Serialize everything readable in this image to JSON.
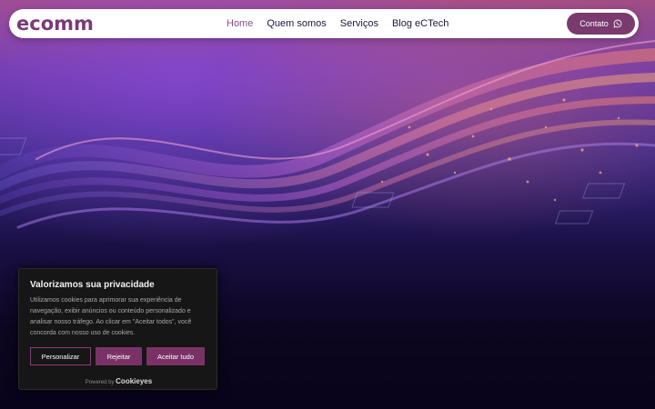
{
  "brand": {
    "logo_text": "ecomm"
  },
  "nav": {
    "links": [
      {
        "label": "Home",
        "active": true
      },
      {
        "label": "Quem somos",
        "active": false
      },
      {
        "label": "Serviços",
        "active": false
      },
      {
        "label": "Blog eCTech",
        "active": false
      }
    ],
    "contact_label": "Contato",
    "contact_icon": "whatsapp-icon"
  },
  "cookie_banner": {
    "title": "Valorizamos sua privacidade",
    "text": "Utilizamos cookies para aprimorar sua experiência de navegação, exibir anúncios ou conteúdo personalizado e analisar nosso tráfego. Ao clicar em \"Aceitar todos\", você concorda com nosso uso de cookies.",
    "buttons": {
      "customize": "Personalizar",
      "reject": "Rejeitar",
      "accept": "Aceitar tudo"
    },
    "powered_by": "Powered by",
    "powered_brand": "Cookieyes"
  },
  "colors": {
    "accent": "#7a3a6e",
    "nav_active": "#8a4c8a",
    "banner_bg": "#161616"
  }
}
